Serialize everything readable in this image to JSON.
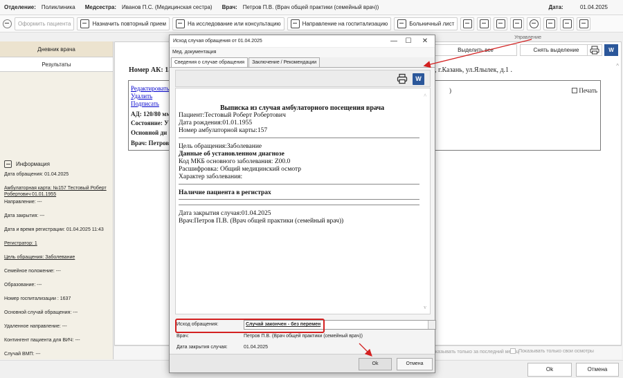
{
  "header": {
    "department_label": "Отделение:",
    "department_value": "Поликлиника",
    "nurse_label": "Медсестра:",
    "nurse_value": "Иванов П.С. (Медицинская сестра)",
    "doctor_label": "Врач:",
    "doctor_value": "Петров П.В. (Врач общей практики (семейный врач))",
    "date_label": "Дата:",
    "date_value": "01.04.2025"
  },
  "toolbar": {
    "register_patient": "Оформить пациента",
    "repeat_appointment": "Назначить повторный прием",
    "research_consult": "На исследование или консультацию",
    "hospitalization": "Направление на госпитализацию",
    "sick_leave": "Больничный лист",
    "management": "Управление"
  },
  "sidebar": {
    "tab_diary": "Дневник врача",
    "tab_results": "Результаты",
    "info_title": "Информация",
    "rows": [
      "Дата обращения: 01.04.2025",
      "Амбулаторная карта: №157 Тестовый Роберт Робертович 01.01.1955",
      "Направление: ---",
      "Дата закрытия: ---",
      "Дата и время регистрации: 01.04.2025 11:43",
      "Регистратор: 1",
      "Цель обращения: Заболевание",
      "Семейное положение: ---",
      "Образование: ---",
      "Номер госпитализации : 1637",
      "Основной случай обращения: ---",
      "Удаленное направление: ---",
      "Контингент пациента для ВИЧ: ---",
      "Случай ВМП: ---"
    ]
  },
  "main": {
    "select_all": "Выделить все",
    "deselect": "Снять выделение",
    "ak_line": "Номер АК: 15",
    "address": "л, г.Казань, ул.Ялылек, д.1 .",
    "edit": "Редактировать",
    "delete": "Удалить",
    "sign": "Подписать",
    "ad": "АД: 120/80 мм",
    "state": "Состояние: У",
    "main_diag": "Основной ди",
    "doctor": "Врач: Петров",
    "paren": ")",
    "print": "Печать",
    "only_last_month": "Показывать только за последний месяц",
    "only_own": "Показывать только свои осмотры"
  },
  "footer": {
    "ok": "Ok",
    "cancel": "Отмена"
  },
  "modal": {
    "title": "Исход случая обращения от 01.04.2025",
    "menu": "Мед. документация",
    "tab1": "Сведения о случае обращения",
    "tab2": "Заключение / Рекомендации",
    "doc": {
      "title": "Выписка из случая амбулаторного посещения врача",
      "patient": "Пациент:Тестовый Роберт Робертович",
      "dob": "Дата рождения:01.01.1955",
      "card": "Номер амбулаторной карты:157",
      "purpose": "Цель обращения:Заболевание",
      "diag_title": "Данные об установленном диагнозе",
      "mkb": "Код МКБ основного заболевания: Z00.0",
      "decode": "Расшифровка: Общий медицинский осмотр",
      "nature": "Характер заболевания:",
      "registers": "Наличие пациента в регистрах",
      "close_date": "Дата закрытия случая:01.04.2025",
      "doctor": "Врач:Петров П.В. (Врач общей практики (семейный врач))"
    },
    "outcome_label": "Исход обращения:",
    "outcome_value": "Случай закончен - без перемен",
    "doctor_label": "Врач:",
    "doctor_value": "Петров П.В. (Врач общей практики (семейный врач))",
    "close_label": "Дата закрытия случая:",
    "close_value": "01.04.2025",
    "ok": "Ok",
    "cancel": "Отмена"
  },
  "colors": {
    "annotation_red": "#d32020",
    "word_blue": "#2b579a",
    "link_blue": "#0000cc",
    "sidebar_bg": "#f3f0e6"
  }
}
